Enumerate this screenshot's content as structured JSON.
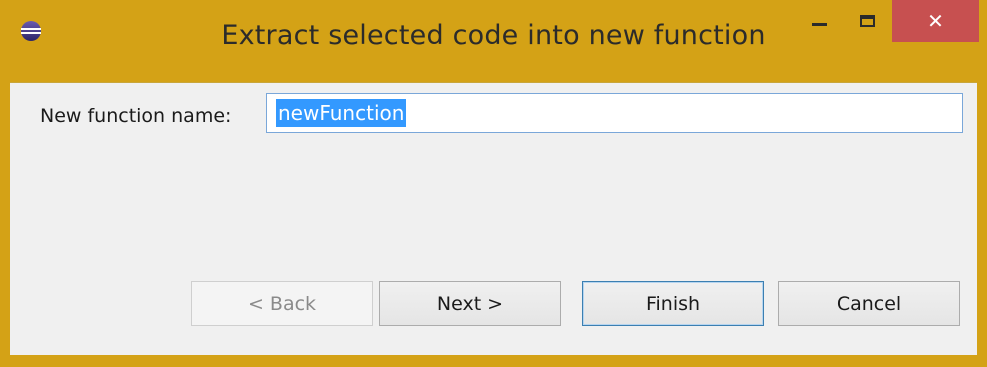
{
  "window": {
    "title": "Extract selected code into new function",
    "controls": {
      "minimize": "minimize",
      "maximize": "maximize",
      "close": "✕"
    },
    "colors": {
      "frame": "#d4a216",
      "close_button": "#c75050",
      "selection": "#3399ff",
      "client": "#f0f0f0"
    }
  },
  "form": {
    "label": "New function name:",
    "value": "newFunction"
  },
  "buttons": {
    "back": "< Back",
    "next": "Next >",
    "finish": "Finish",
    "cancel": "Cancel"
  }
}
